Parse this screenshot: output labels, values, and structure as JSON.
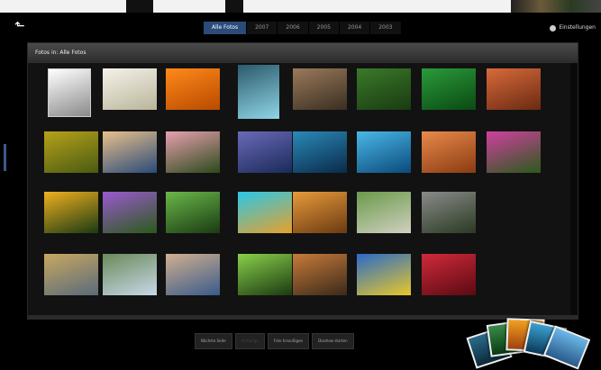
{
  "toolbar": {
    "back_icon": "back-arrow-icon",
    "tabs": [
      {
        "label": "Alle Fotos",
        "active": true
      },
      {
        "label": "2007",
        "active": false
      },
      {
        "label": "2006",
        "active": false
      },
      {
        "label": "2005",
        "active": false
      },
      {
        "label": "2004",
        "active": false
      },
      {
        "label": "2003",
        "active": false
      }
    ],
    "settings_label": "Einstellungen",
    "settings_icon": "gear-icon"
  },
  "panel": {
    "title": "Fotos in: Alle Fotos"
  },
  "thumbnails": [
    {
      "row": 0,
      "col": 0,
      "colors": [
        "#ffffff",
        "#8a8a8a"
      ]
    },
    {
      "row": 0,
      "col": 1,
      "colors": [
        "#f4f2ea",
        "#b9b59a"
      ]
    },
    {
      "row": 0,
      "col": 2,
      "colors": [
        "#ff8a1a",
        "#b84a00"
      ]
    },
    {
      "row": 0,
      "col": 3,
      "colors": [
        "#2b5a6a",
        "#8fd6e8"
      ]
    },
    {
      "row": 0,
      "col": 4,
      "colors": [
        "#9a7a5a",
        "#3a2e22"
      ]
    },
    {
      "row": 0,
      "col": 5,
      "colors": [
        "#3a7a2a",
        "#1a3a12"
      ]
    },
    {
      "row": 0,
      "col": 6,
      "colors": [
        "#2a9a3a",
        "#0a4a12"
      ]
    },
    {
      "row": 0,
      "col": 7,
      "colors": [
        "#d86a3a",
        "#6a2a12"
      ]
    },
    {
      "row": 1,
      "col": 0,
      "colors": [
        "#b6a21a",
        "#4a5a12"
      ]
    },
    {
      "row": 1,
      "col": 1,
      "colors": [
        "#e8c08a",
        "#2a4a7a"
      ]
    },
    {
      "row": 1,
      "col": 2,
      "colors": [
        "#e8a0b0",
        "#2a4a1a"
      ]
    },
    {
      "row": 1,
      "col": 3,
      "colors": [
        "#6a6ab8",
        "#1a2a5a"
      ]
    },
    {
      "row": 1,
      "col": 4,
      "colors": [
        "#2a8ab8",
        "#0a2a4a"
      ]
    },
    {
      "row": 1,
      "col": 5,
      "colors": [
        "#4ab8e8",
        "#0a4a7a"
      ]
    },
    {
      "row": 1,
      "col": 6,
      "colors": [
        "#e88a4a",
        "#8a3a12"
      ]
    },
    {
      "row": 1,
      "col": 7,
      "colors": [
        "#d040a0",
        "#2a5a1a"
      ]
    },
    {
      "row": 2,
      "col": 0,
      "colors": [
        "#f0b020",
        "#1a3a12"
      ]
    },
    {
      "row": 2,
      "col": 1,
      "colors": [
        "#9a5ad0",
        "#2a5a1a"
      ]
    },
    {
      "row": 2,
      "col": 2,
      "colors": [
        "#6ab84a",
        "#1a3a12"
      ]
    },
    {
      "row": 2,
      "col": 3,
      "colors": [
        "#2ac8e8",
        "#e8a02a"
      ]
    },
    {
      "row": 2,
      "col": 4,
      "colors": [
        "#e89a3a",
        "#6a3a12"
      ]
    },
    {
      "row": 2,
      "col": 5,
      "colors": [
        "#6a9a4a",
        "#d0d0c0"
      ]
    },
    {
      "row": 2,
      "col": 6,
      "colors": [
        "#8a8a8a",
        "#2a3a22"
      ]
    },
    {
      "row": 3,
      "col": 0,
      "colors": [
        "#c8a860",
        "#5a6a7a"
      ]
    },
    {
      "row": 3,
      "col": 1,
      "colors": [
        "#6a8a5a",
        "#c8d8e8"
      ]
    },
    {
      "row": 3,
      "col": 2,
      "colors": [
        "#d0b090",
        "#3a5a8a"
      ]
    },
    {
      "row": 3,
      "col": 3,
      "colors": [
        "#8ad04a",
        "#1a3a12"
      ]
    },
    {
      "row": 3,
      "col": 4,
      "colors": [
        "#c87a3a",
        "#3a2a1a"
      ]
    },
    {
      "row": 3,
      "col": 5,
      "colors": [
        "#2a6ac8",
        "#e8c82a"
      ]
    },
    {
      "row": 3,
      "col": 6,
      "colors": [
        "#d02a3a",
        "#5a0a12"
      ]
    }
  ],
  "bottom_buttons": [
    {
      "label": "Nächste Seite",
      "disabled": false
    },
    {
      "label": "Vorherige",
      "disabled": true
    },
    {
      "label": "Foto hinzufügen",
      "disabled": false
    },
    {
      "label": "Diashow starten",
      "disabled": false
    }
  ],
  "colors": {
    "active_tab": "#2b4c7a",
    "panel_bg": "#121212"
  }
}
